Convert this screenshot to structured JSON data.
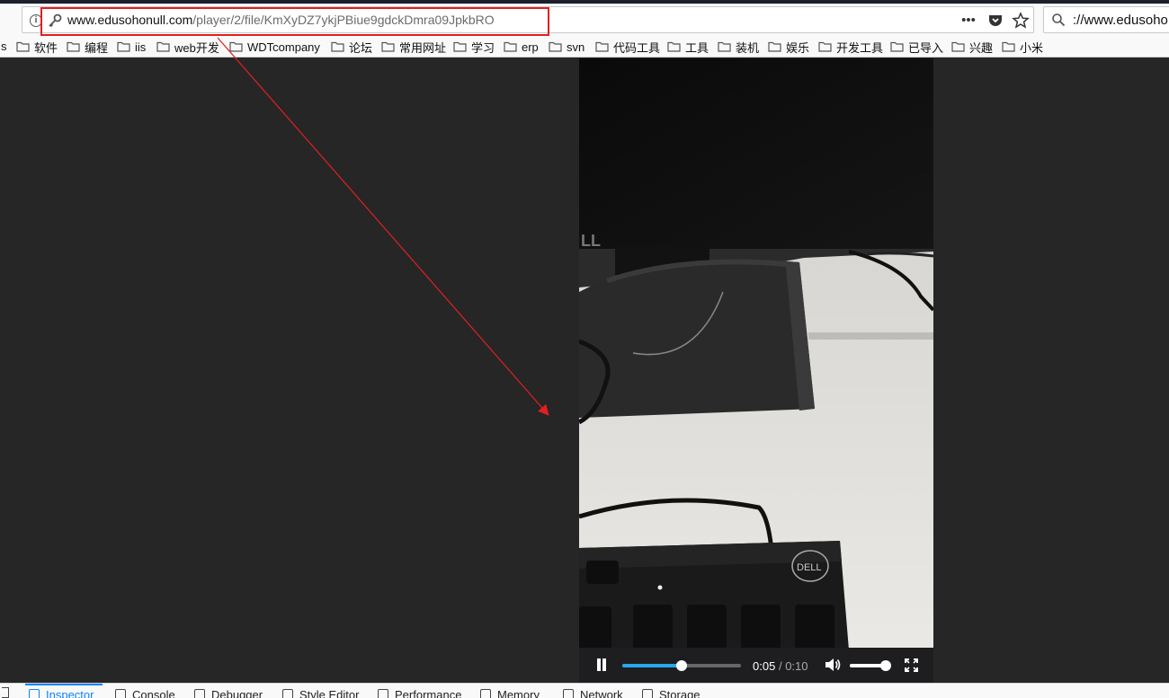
{
  "browser": {
    "url_domain": "www.edusohonull.com",
    "url_path": "/player/2/file/KmXyDZ7ykjPBiue9gdckDmra09JpkbRO",
    "search_text": "://www.edusoho",
    "icons": [
      "info-icon",
      "key-icon",
      "more-icon",
      "pocket-icon",
      "star-icon",
      "search-icon"
    ]
  },
  "bookmarks": {
    "prefix": "s",
    "items": [
      "软件",
      "编程",
      "iis",
      "web开发",
      "WDTcompany",
      "论坛",
      "常用网址",
      "学习",
      "erp",
      "svn",
      "代码工具",
      "工具",
      "装机",
      "娱乐",
      "开发工具",
      "已导入",
      "兴趣",
      "小米"
    ]
  },
  "player": {
    "current_time": "0:05",
    "separator": "/",
    "duration": "0:10",
    "progress": 0.5,
    "volume": 0.9
  },
  "devtools": {
    "tabs": [
      "Inspector",
      "Console",
      "Debugger",
      "Style Editor",
      "Performance",
      "Memory",
      "Network",
      "Storage"
    ],
    "active_tab": "Inspector"
  },
  "colors": {
    "accent": "#29a7ec",
    "annotation": "#e02020",
    "page_bg": "#262626"
  }
}
